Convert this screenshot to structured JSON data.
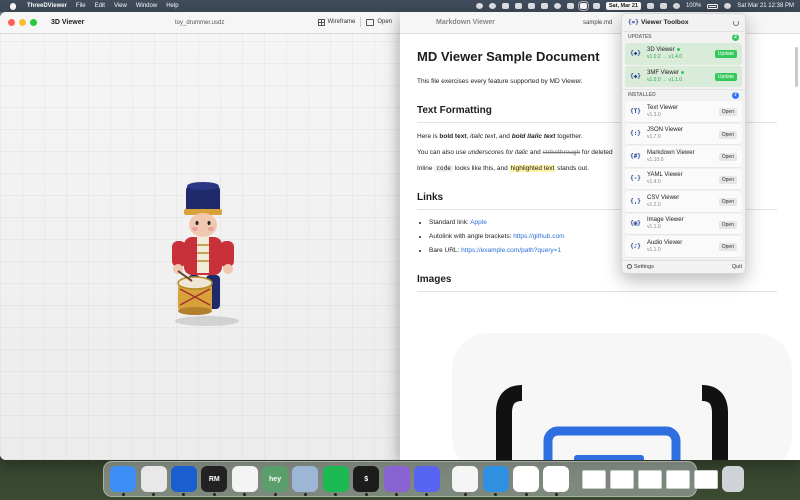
{
  "menubar": {
    "app_name": "ThreeDViewer",
    "menus": [
      "File",
      "Edit",
      "View",
      "Window",
      "Help"
    ],
    "battery": "100%",
    "date_badge": "Sat, Mar 21",
    "clock": "Sat Mar 21  12:38 PM"
  },
  "viewer3d": {
    "title": "3D Viewer",
    "document": "toy_drummer.usdz",
    "wireframe_label": "Wireframe",
    "open_label": "Open"
  },
  "markdown": {
    "title": "Markdown Viewer",
    "document": "sample.md",
    "h1": "MD Viewer Sample Document",
    "intro": "This file exercises every feature supported by MD Viewer.",
    "formatting": {
      "heading": "Text Formatting",
      "line1_a": "Here is ",
      "line1_bold": "bold text",
      "line1_b": ", ",
      "line1_italic": "italic text",
      "line1_c": ", and ",
      "line1_bolditalic": "bold italic text",
      "line1_d": " together.",
      "line2_a": "You can also use ",
      "line2_italic": "underscores for italic",
      "line2_b": " and ",
      "line2_strike": "strikethrough",
      "line2_c": " for deleted",
      "line3_a": "Inline ",
      "line3_code": "code",
      "line3_b": " looks like this, and ",
      "line3_highlight": "highlighted text",
      "line3_c": " stands out."
    },
    "links": {
      "heading": "Links",
      "items": [
        {
          "label": "Standard link: ",
          "link": "Apple"
        },
        {
          "label": "Autolink with angle brackets: ",
          "link": "https://github.com"
        },
        {
          "label": "Bare URL: ",
          "link": "https://example.com/path?query=1"
        }
      ]
    },
    "images_heading": "Images"
  },
  "toolbox": {
    "title": "Viewer Toolbox",
    "updates_label": "UPDATES",
    "updates_count": "2",
    "installed_label": "INSTALLED",
    "installed_count": "7",
    "update_button": "Update",
    "open_button": "Open",
    "updates": [
      {
        "name": "3D Viewer",
        "version": "v1.0.2 → v1.4.0"
      },
      {
        "name": "3MF Viewer",
        "version": "v1.0.0 → v1.1.0"
      }
    ],
    "installed": [
      {
        "name": "Text Viewer",
        "version": "v1.3.0"
      },
      {
        "name": "JSON Viewer",
        "version": "v1.7.0"
      },
      {
        "name": "Markdown Viewer",
        "version": "v1.10.0"
      },
      {
        "name": "YAML Viewer",
        "version": "v1.4.0"
      },
      {
        "name": "CSV Viewer",
        "version": "v1.2.0"
      },
      {
        "name": "Image Viewer",
        "version": "v1.1.0"
      },
      {
        "name": "Audio Viewer",
        "version": "v1.1.0"
      }
    ],
    "settings_label": "Settings",
    "quit_label": "Quit"
  },
  "dock": {
    "apps": [
      {
        "icon": "finder-icon",
        "color": "#3e8ef7"
      },
      {
        "icon": "chrome-icon",
        "color": "#e8e8e8"
      },
      {
        "icon": "1password-icon",
        "color": "#1a5fd0"
      },
      {
        "icon": "rubymine-icon",
        "color": "#222222",
        "text": "RM"
      },
      {
        "icon": "slack-icon",
        "color": "#f4f4f4"
      },
      {
        "icon": "hey-icon",
        "color": "#5a9e6b",
        "text": "hey"
      },
      {
        "icon": "preview-icon",
        "color": "#9db6d6"
      },
      {
        "icon": "spotify-icon",
        "color": "#1db954"
      },
      {
        "icon": "terminal-icon",
        "color": "#1c1c1c",
        "text": "$"
      },
      {
        "icon": "arc-icon",
        "color": "#8a63d2"
      },
      {
        "icon": "discord-icon",
        "color": "#5865f2"
      }
    ],
    "apps2": [
      {
        "icon": "chatgpt-icon",
        "color": "#f5f5f5"
      },
      {
        "icon": "markdown-viewer-icon",
        "color": "#2f8fe0"
      },
      {
        "icon": "toolbox-icon",
        "color": "#ffffff"
      },
      {
        "icon": "3d-viewer-icon",
        "color": "#ffffff"
      }
    ]
  }
}
